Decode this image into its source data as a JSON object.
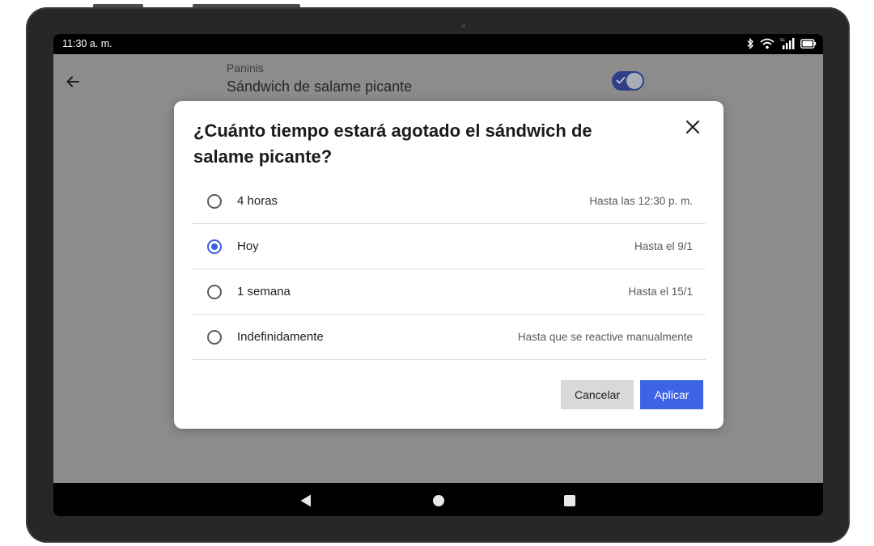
{
  "status_bar": {
    "time": "11:30 a. m."
  },
  "app": {
    "category": "Paninis",
    "item_name": "Sándwich de salame picante",
    "availability_toggle_on": true,
    "accent_color": "#2f3f86"
  },
  "dialog": {
    "title": "¿Cuánto tiempo estará agotado el sándwich de salame picante?",
    "options": [
      {
        "label": "4 horas",
        "detail": "Hasta las 12:30 p. m.",
        "selected": false
      },
      {
        "label": "Hoy",
        "detail": "Hasta el 9/1",
        "selected": true
      },
      {
        "label": "1 semana",
        "detail": "Hasta el 15/1",
        "selected": false
      },
      {
        "label": "Indefinidamente",
        "detail": "Hasta que se reactive manualmente",
        "selected": false
      }
    ],
    "cancel_label": "Cancelar",
    "apply_label": "Aplicar",
    "primary_color": "#3d63e6"
  },
  "icons": {
    "back": "arrow-left-icon",
    "close": "close-icon",
    "bluetooth": "bluetooth-icon",
    "wifi": "wifi-icon",
    "signal": "cell-signal-icon",
    "battery": "battery-icon",
    "nav_back": "triangle-back-icon",
    "nav_home": "circle-home-icon",
    "nav_recent": "square-recents-icon"
  }
}
